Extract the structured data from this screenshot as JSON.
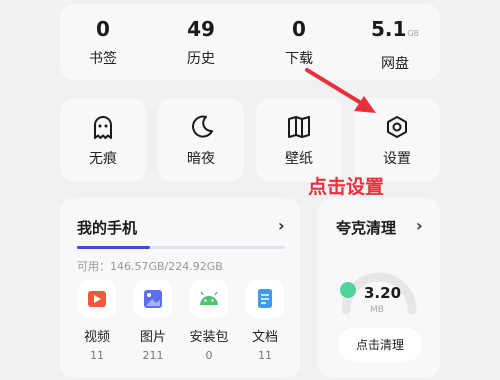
{
  "stats": [
    {
      "value": "0",
      "unit": "",
      "label": "书签"
    },
    {
      "value": "49",
      "unit": "",
      "label": "历史"
    },
    {
      "value": "0",
      "unit": "",
      "label": "下载"
    },
    {
      "value": "5.1",
      "unit": "GB",
      "label": "网盘"
    }
  ],
  "tools": [
    {
      "label": "无痕",
      "icon": "ghost-icon"
    },
    {
      "label": "暗夜",
      "icon": "moon-icon"
    },
    {
      "label": "壁纸",
      "icon": "book-icon"
    },
    {
      "label": "设置",
      "icon": "gear-icon"
    }
  ],
  "phone": {
    "title": "我的手机",
    "storage_text": "可用：146.57GB/224.92GB",
    "used_fraction": 0.35,
    "categories": [
      {
        "name": "视频",
        "count": "11",
        "icon": "video-icon",
        "color": "#f2573d"
      },
      {
        "name": "图片",
        "count": "211",
        "icon": "image-icon",
        "color": "#5b6ef5"
      },
      {
        "name": "安装包",
        "count": "0",
        "icon": "android-icon",
        "color": "#4cc474"
      },
      {
        "name": "文档",
        "count": "11",
        "icon": "document-icon",
        "color": "#3e9bf0"
      }
    ]
  },
  "cleaner": {
    "title": "夸克清理",
    "value": "3.20",
    "unit": "MB",
    "button": "点击清理"
  },
  "annotation": {
    "text": "点击设置",
    "color": "#e8303d"
  }
}
